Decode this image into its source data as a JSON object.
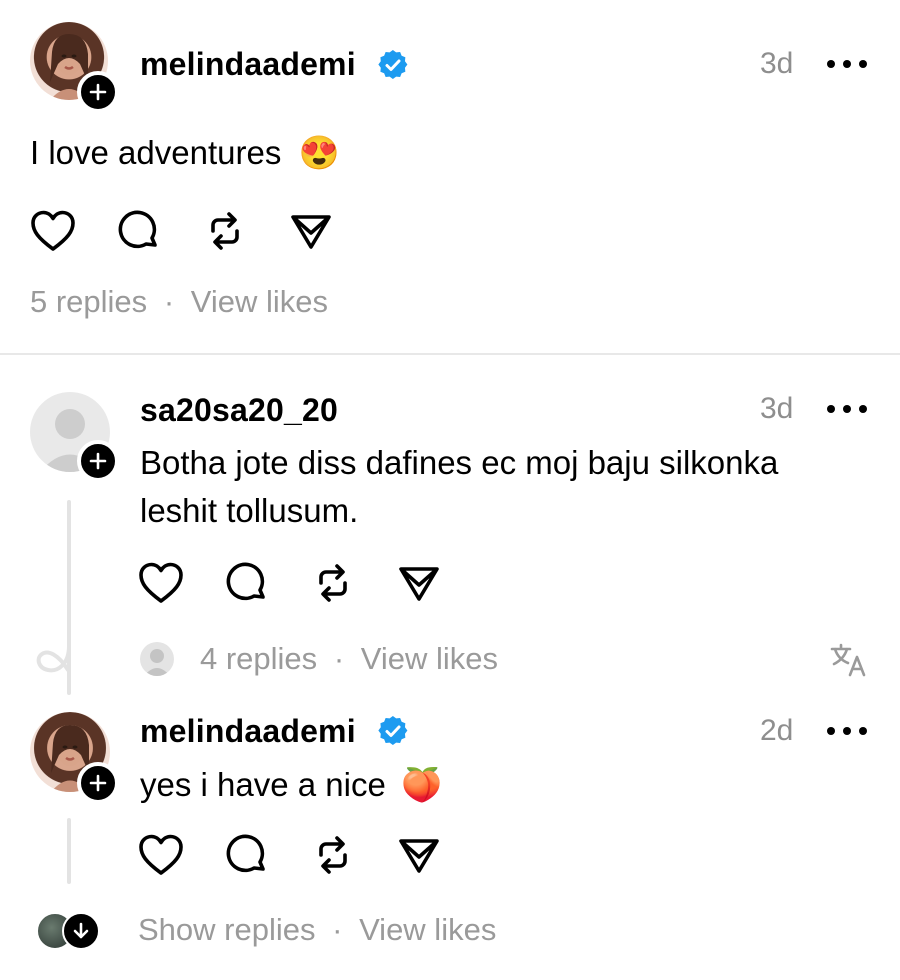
{
  "post": {
    "username": "melindaademi",
    "time": "3d",
    "text": "I love adventures",
    "emoji": "😍",
    "replies": "5 replies",
    "separator": "·",
    "view_likes": "View likes"
  },
  "reply1": {
    "username": "sa20sa20_20",
    "time": "3d",
    "text_line1": "Botha jote diss dafines ec moj baju silkonka",
    "text_line2": "leshit tollusum.",
    "replies": "4 replies",
    "separator": "·",
    "view_likes": "View likes"
  },
  "reply2": {
    "username": "melindaademi",
    "time": "2d",
    "text": "yes i have a nice",
    "emoji": "🍑",
    "show_replies": "Show replies",
    "separator": "·",
    "view_likes": "View likes"
  },
  "colors": {
    "verified_blue": "#1d9bf0",
    "meta_gray": "#9a9a9a",
    "divider": "#e8e8e8"
  }
}
